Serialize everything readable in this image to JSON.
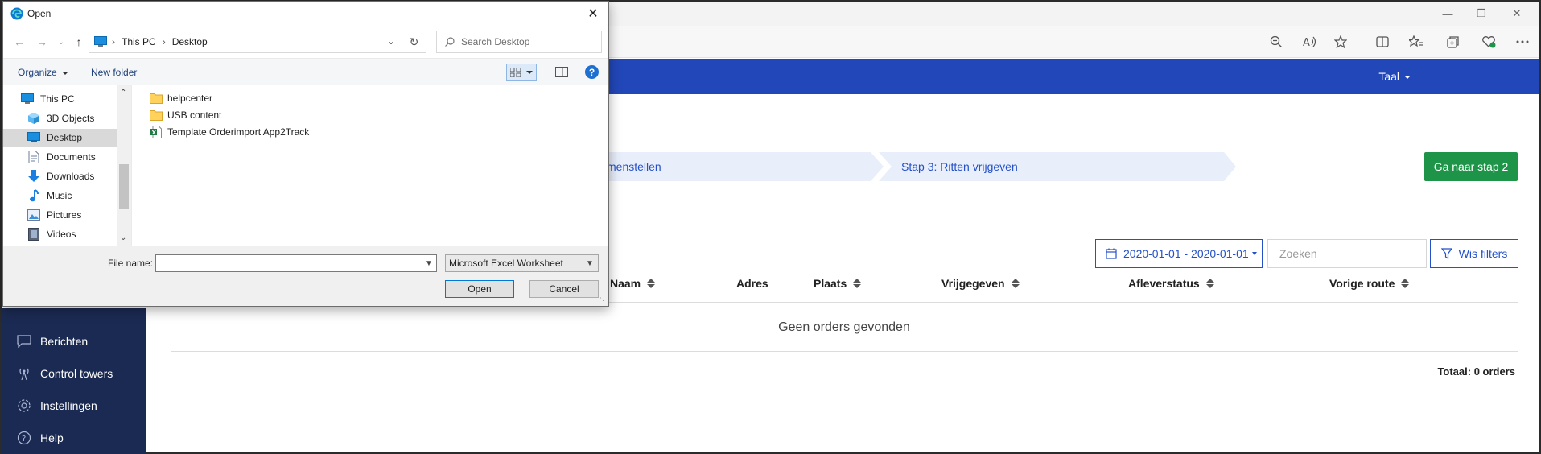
{
  "app": {
    "taal_label": "Taal",
    "steps": [
      {
        "label": "menstellen"
      },
      {
        "label": "Stap 3: Ritten vrijgeven"
      }
    ],
    "next_step_button": "Ga naar stap 2",
    "date_filter": "2020-01-01 - 2020-01-01",
    "search_placeholder": "Zoeken",
    "clear_filters": "Wis filters",
    "columns": [
      "Naam",
      "Adres",
      "Plaats",
      "Vrijgegeven",
      "Afleverstatus",
      "Vorige route"
    ],
    "empty_text": "Geen orders gevonden",
    "total_text": "Totaal: 0 orders",
    "nav": [
      {
        "label": "Berichten",
        "icon": "message-icon"
      },
      {
        "label": "Control towers",
        "icon": "tower-icon"
      },
      {
        "label": "Instellingen",
        "icon": "gear-icon"
      },
      {
        "label": "Help",
        "icon": "help-icon"
      }
    ],
    "colors": {
      "header": "#2247b8",
      "sidebar": "#1b2a52",
      "accent": "#2451c9",
      "success": "#1e9448"
    }
  },
  "dialog": {
    "title": "Open",
    "breadcrumb": [
      "This PC",
      "Desktop"
    ],
    "search_placeholder": "Search Desktop",
    "organize": "Organize",
    "new_folder": "New folder",
    "nav_items": [
      {
        "label": "This PC",
        "icon": "computer-icon"
      },
      {
        "label": "3D Objects",
        "icon": "cube-icon"
      },
      {
        "label": "Desktop",
        "icon": "desktop-icon"
      },
      {
        "label": "Documents",
        "icon": "document-icon"
      },
      {
        "label": "Downloads",
        "icon": "download-icon"
      },
      {
        "label": "Music",
        "icon": "music-icon"
      },
      {
        "label": "Pictures",
        "icon": "picture-icon"
      },
      {
        "label": "Videos",
        "icon": "video-icon"
      }
    ],
    "files": [
      {
        "name": "helpcenter",
        "icon": "folder-icon"
      },
      {
        "name": "USB content",
        "icon": "folder-icon"
      },
      {
        "name": "Template Orderimport App2Track",
        "icon": "excel-file-icon"
      }
    ],
    "file_name_label": "File name:",
    "file_name_value": "",
    "file_type": "Microsoft Excel Worksheet",
    "open_button": "Open",
    "cancel_button": "Cancel"
  }
}
